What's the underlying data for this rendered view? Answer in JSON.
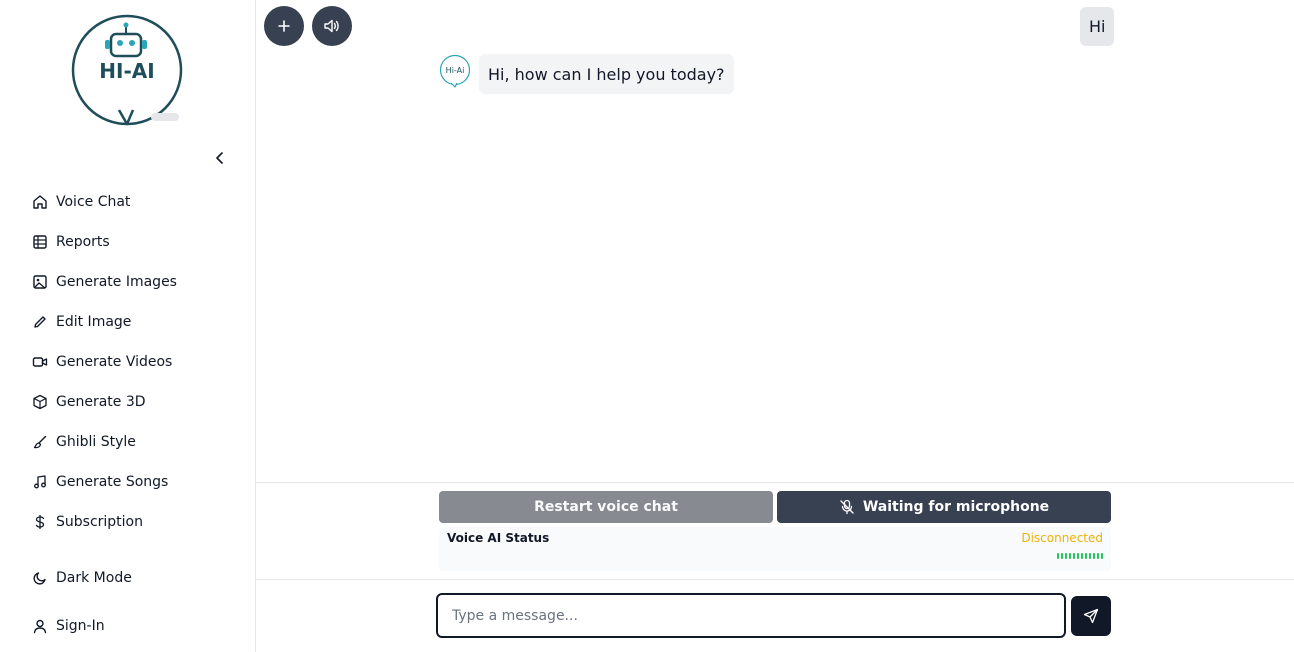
{
  "sidebar": {
    "logo_text": "HI-AI",
    "nav": [
      {
        "label": "Voice Chat",
        "icon": "home-icon"
      },
      {
        "label": "Reports",
        "icon": "table-icon"
      },
      {
        "label": "Generate Images",
        "icon": "image-icon"
      },
      {
        "label": "Edit Image",
        "icon": "pencil-icon"
      },
      {
        "label": "Generate Videos",
        "icon": "video-icon"
      },
      {
        "label": "Generate 3D",
        "icon": "cube-icon"
      },
      {
        "label": "Ghibli Style",
        "icon": "brush-icon"
      },
      {
        "label": "Generate Songs",
        "icon": "music-icon"
      },
      {
        "label": "Subscription",
        "icon": "dollar-icon"
      }
    ],
    "dark_mode_label": "Dark Mode",
    "sign_in_label": "Sign-In"
  },
  "chat": {
    "user_message": "Hi",
    "bot_avatar_text": "Hi-Ai",
    "bot_message": "Hi, how can I help you today?"
  },
  "voice": {
    "restart_label": "Restart voice chat",
    "mic_label": "Waiting for microphone",
    "status_title": "Voice AI Status",
    "status_value": "Disconnected"
  },
  "composer": {
    "placeholder": "Type a message..."
  },
  "colors": {
    "primary_dark": "#374151",
    "status_warning": "#eab308",
    "status_level": "#22c55e",
    "logo_teal": "#1f4e5a"
  }
}
